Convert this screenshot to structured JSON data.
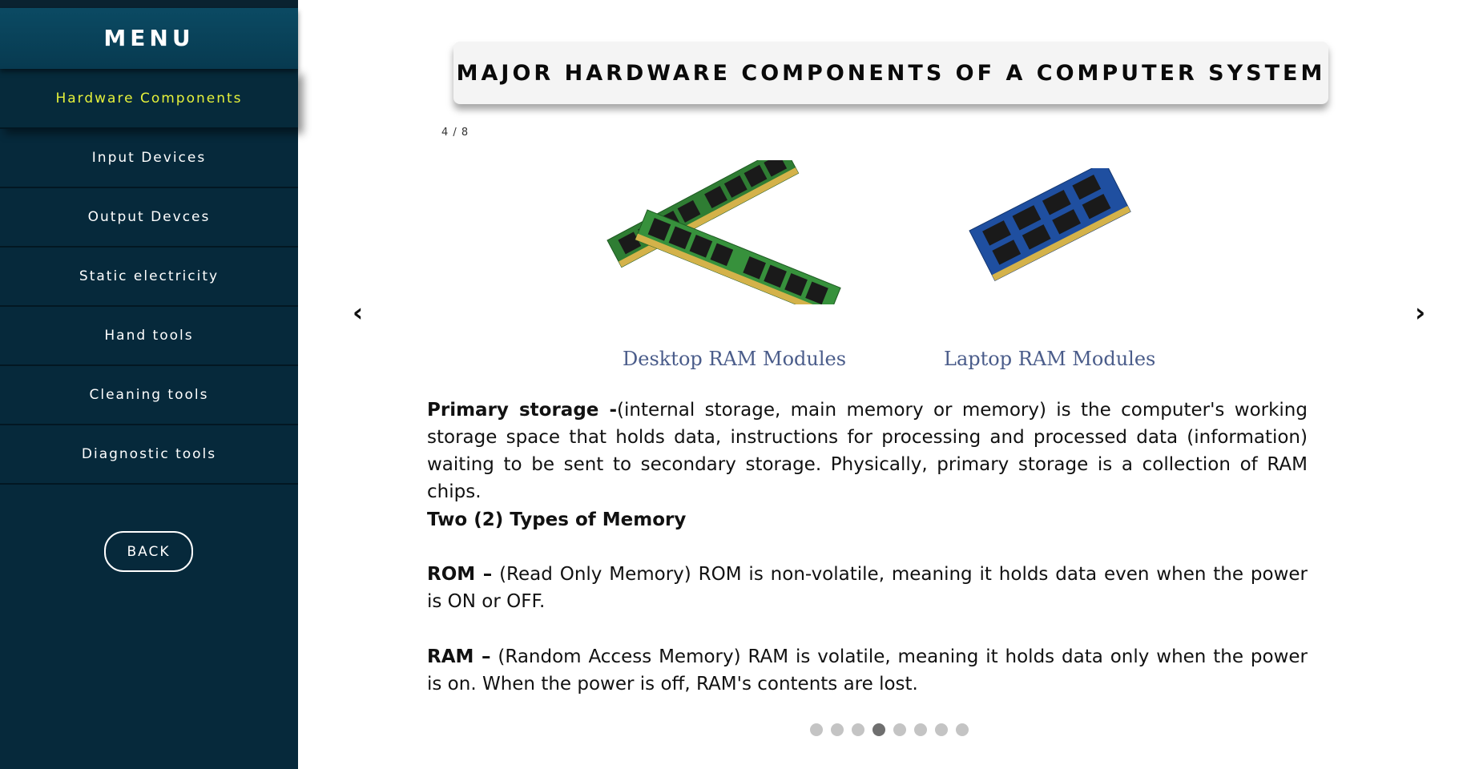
{
  "sidebar": {
    "menu_title": "MENU",
    "items": [
      {
        "label": "Hardware Components",
        "active": true
      },
      {
        "label": "Input Devices",
        "active": false
      },
      {
        "label": "Output Devces",
        "active": false
      },
      {
        "label": "Static electricity",
        "active": false
      },
      {
        "label": "Hand tools",
        "active": false
      },
      {
        "label": "Cleaning tools",
        "active": false
      },
      {
        "label": "Diagnostic tools",
        "active": false
      }
    ],
    "back_label": "BACK"
  },
  "main": {
    "title": "MAJOR HARDWARE COMPONENTS OF A COMPUTER SYSTEM",
    "slide_counter": "4 / 8",
    "prev_arrow": "‹",
    "next_arrow": "›",
    "images": [
      {
        "caption": "Desktop RAM Modules",
        "icon": "desktop-ram-image"
      },
      {
        "caption": "Laptop RAM Modules",
        "icon": "laptop-ram-image"
      }
    ],
    "paragraphs": {
      "primary_bold": "Primary storage -",
      "primary_text": "(internal storage, main memory or memory) is the computer's working storage space that holds data, instructions for processing and processed data (information) waiting to be sent to secondary storage. Physically, primary storage is a collection of RAM chips.",
      "types_heading": "Two (2) Types of Memory",
      "rom_bold": "ROM –",
      "rom_text": " (Read Only Memory) ROM is non-volatile, meaning it holds data even when the power is ON or OFF.",
      "ram_bold": "RAM –",
      "ram_text": " (Random Access Memory) RAM is volatile, meaning it holds data only when the power is on. When the power is off, RAM's contents are lost."
    },
    "dots": {
      "count": 8,
      "active_index": 3
    }
  },
  "colors": {
    "sidebar_bg": "#06293b",
    "active_item_text": "#e6f23a",
    "caption_text": "#4a5c8a",
    "pcb_green": "#2e7d32",
    "pcb_blue": "#1f4fa0",
    "chip_black": "#1a1a1a",
    "gold_contacts": "#d4b24a"
  }
}
